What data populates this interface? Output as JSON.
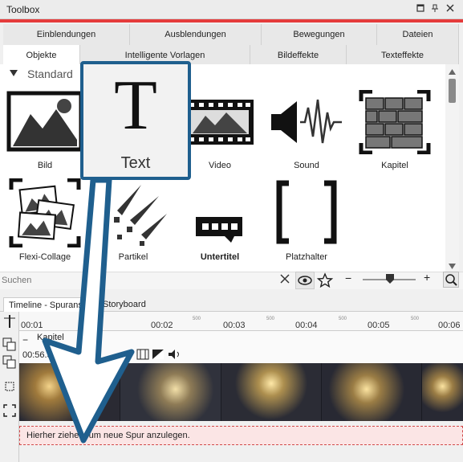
{
  "window": {
    "title": "Toolbox",
    "controls": [
      "restore-icon",
      "pin-icon",
      "close-icon"
    ]
  },
  "tabs_row1": [
    "Einblendungen",
    "Ausblendungen",
    "Bewegungen",
    "Dateien"
  ],
  "tabs_row2": [
    "Objekte",
    "Intelligente Vorlagen",
    "Bildeffekte",
    "Texteffekte"
  ],
  "section": {
    "label": "Standard"
  },
  "tools": [
    {
      "label": "Bild",
      "icon": "image-icon"
    },
    {
      "label": "Text",
      "icon": "text-icon"
    },
    {
      "label": "Video",
      "icon": "video-icon"
    },
    {
      "label": "Sound",
      "icon": "sound-icon"
    },
    {
      "label": "Kapitel",
      "icon": "chapter-icon"
    },
    {
      "label": "Flexi-Collage",
      "icon": "collage-icon"
    },
    {
      "label": "Partikel",
      "icon": "particle-icon"
    },
    {
      "label": "Untertitel",
      "icon": "subtitle-icon"
    },
    {
      "label": "Platzhalter",
      "icon": "placeholder-icon"
    }
  ],
  "drag_preview": {
    "glyph": "T",
    "label": "Text"
  },
  "search": {
    "placeholder": "Suchen"
  },
  "zoom": {
    "minus": "−",
    "plus": "+"
  },
  "timeline": {
    "tabs": [
      "Timeline - Spuransicht",
      "Storyboard"
    ],
    "ruler_labels": [
      "00:01",
      "00:02",
      "00:03",
      "00:04",
      "00:05",
      "00:06"
    ],
    "ruler_small": [
      "500",
      "500",
      "500",
      "500",
      "500"
    ],
    "track_name": "Kapitel",
    "track_time": "00:56.3",
    "drop_hint": "Hierher ziehen, um neue Spur anzulegen."
  },
  "colors": {
    "accent": "#e53b3b",
    "drag_border": "#1f5f8e",
    "arrow": "#1f5f8e"
  }
}
